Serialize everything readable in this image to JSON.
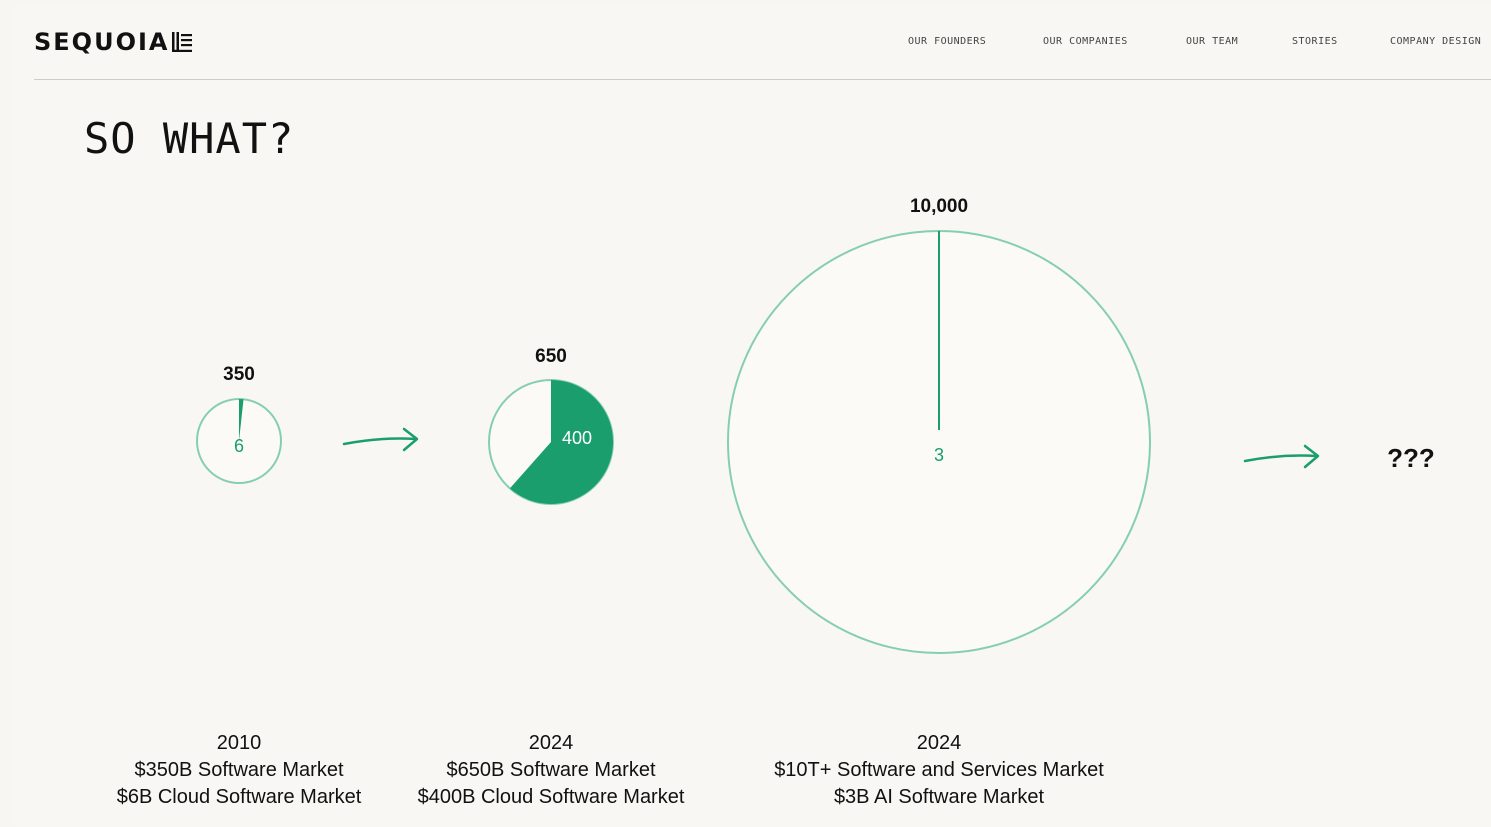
{
  "brand": {
    "name": "SEQUOIA"
  },
  "nav": {
    "items": [
      "OUR FOUNDERS",
      "OUR COMPANIES",
      "OUR TEAM",
      "STORIES",
      "COMPANY DESIGN"
    ]
  },
  "heading": "SO WHAT?",
  "colors": {
    "accent": "#1a9e6e",
    "outline": "#86cfae",
    "background": "#f9f7f3",
    "text": "#111111"
  },
  "chart_data": {
    "type": "pie",
    "charts": [
      {
        "total": 350,
        "total_label": "350",
        "part": 6,
        "part_label": "6",
        "caption": [
          "2010",
          "$350B Software Market",
          "$6B Cloud Software Market"
        ]
      },
      {
        "total": 650,
        "total_label": "650",
        "part": 400,
        "part_label": "400",
        "caption": [
          "2024",
          "$650B Software Market",
          "$400B Cloud Software Market"
        ]
      },
      {
        "total": 10000,
        "total_label": "10,000",
        "part": 3,
        "part_label": "3",
        "caption": [
          "2024",
          "$10T+ Software and Services Market",
          "$3B AI Software Market"
        ]
      }
    ],
    "next_label": "???"
  }
}
